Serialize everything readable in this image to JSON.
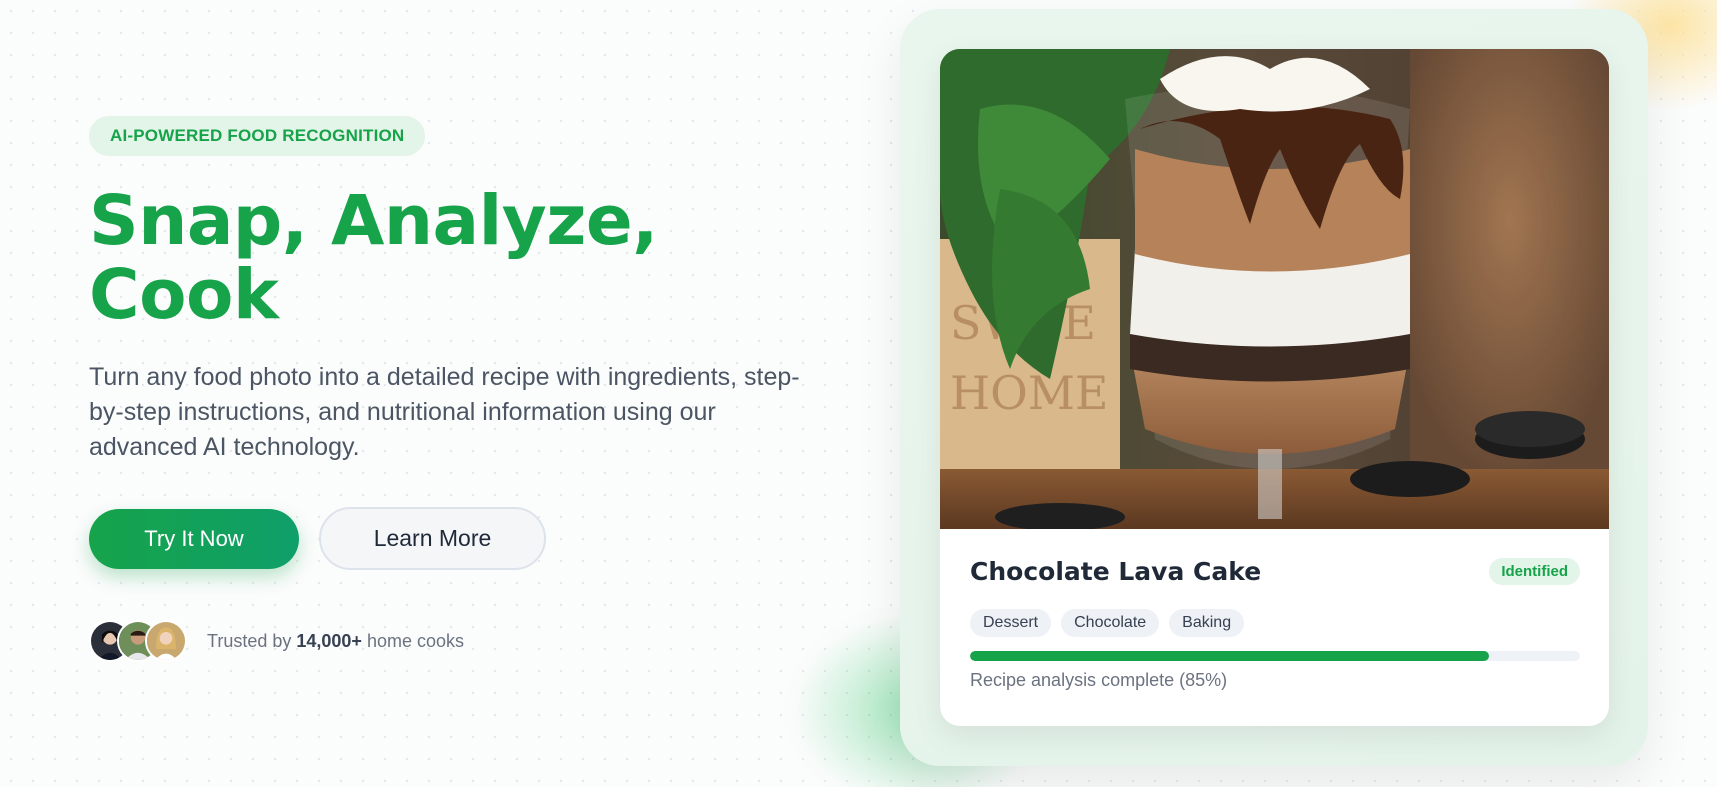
{
  "hero": {
    "badge": "AI-POWERED FOOD RECOGNITION",
    "headline": "Snap, Analyze, Cook",
    "subtitle": "Turn any food photo into a detailed recipe with ingredients, step-by-step instructions, and nutritional information using our advanced AI technology.",
    "primary_button": "Try It Now",
    "secondary_button": "Learn More",
    "trust_prefix": "Trusted by ",
    "trust_count": "14,000+",
    "trust_suffix": " home cooks"
  },
  "result_card": {
    "image_icon": "chocolate-dessert-photo",
    "dish_name": "Chocolate Lava Cake",
    "status": "Identified",
    "tags": [
      "Dessert",
      "Chocolate",
      "Baking"
    ],
    "progress_percent": 85,
    "progress_label": "Recipe analysis complete (85%)"
  },
  "colors": {
    "brand": "#16a34a",
    "badge_bg": "#e3f4e8",
    "text_muted": "#6b7280"
  }
}
